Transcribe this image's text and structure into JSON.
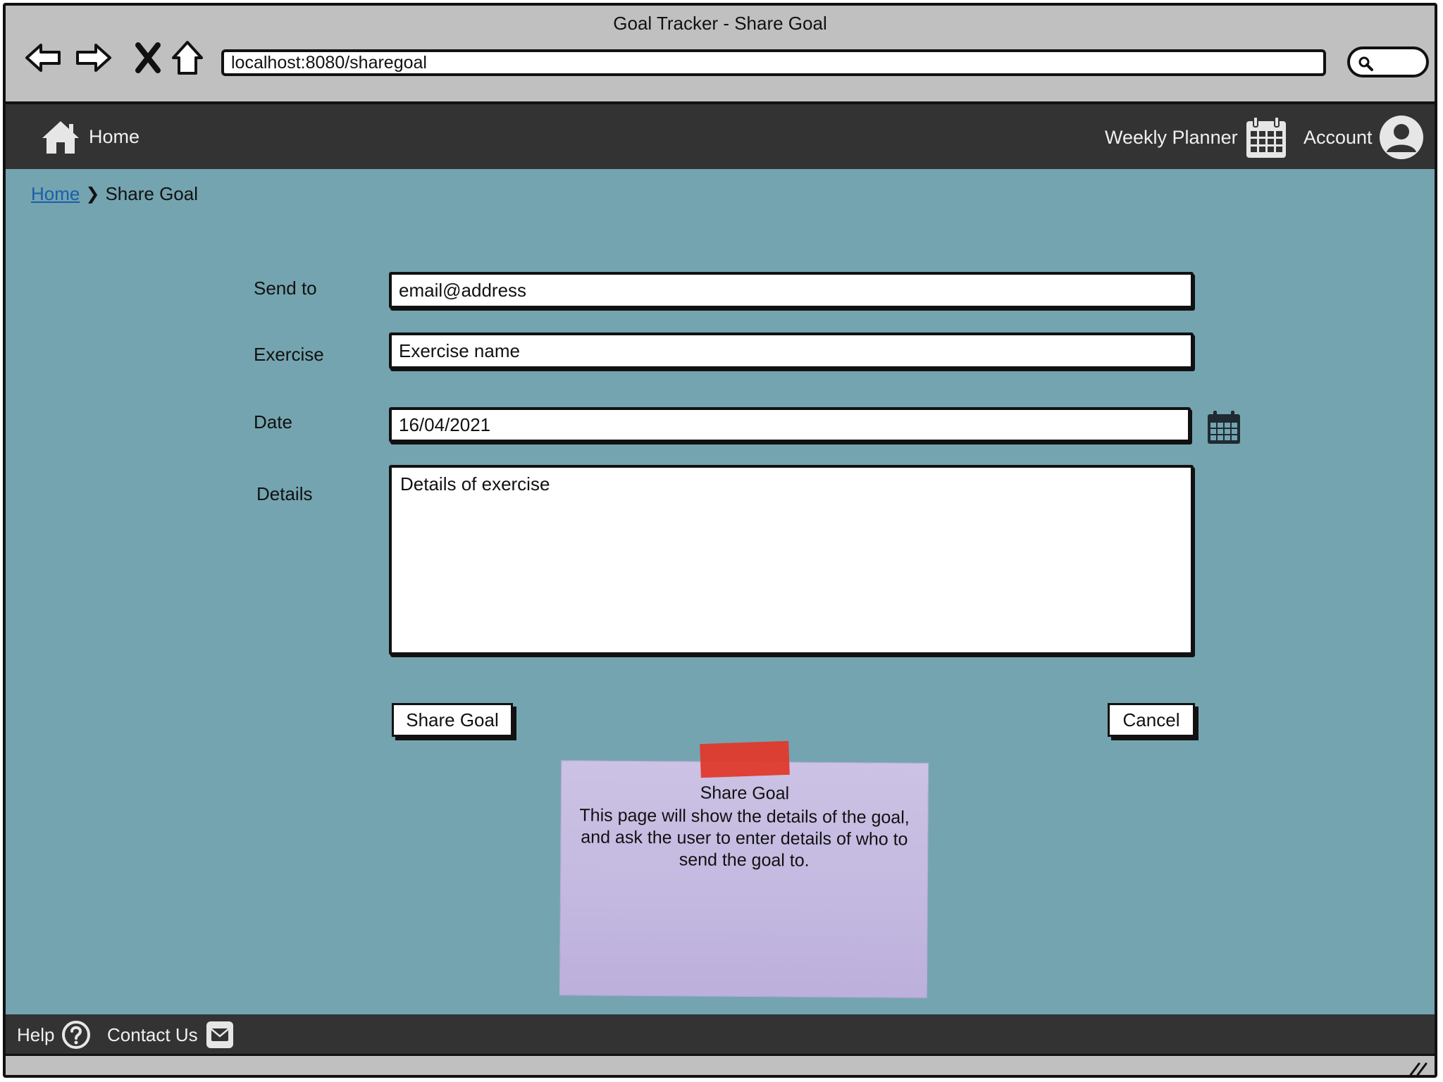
{
  "window": {
    "title": "Goal Tracker - Share Goal"
  },
  "browser": {
    "url": "localhost:8080/sharegoal",
    "icons": [
      "back-arrow-icon",
      "forward-arrow-icon",
      "stop-icon",
      "home-icon",
      "search-icon"
    ]
  },
  "topnav": {
    "home_label": "Home",
    "planner_label": "Weekly Planner",
    "account_label": "Account"
  },
  "breadcrumb": {
    "home": "Home",
    "current": "Share Goal"
  },
  "form": {
    "send_to_label": "Send to",
    "send_to_value": "email@address",
    "exercise_label": "Exercise",
    "exercise_value": "Exercise name",
    "date_label": "Date",
    "date_value": "16/04/2021",
    "details_label": "Details",
    "details_value": "Details of exercise",
    "share_button": "Share Goal",
    "cancel_button": "Cancel"
  },
  "note": {
    "title": "Share Goal",
    "body": "This page will show the details of the goal, and ask the user to enter details of who to send the goal to."
  },
  "footer": {
    "help_label": "Help",
    "contact_label": "Contact Us"
  },
  "colors": {
    "page_bg": "#74a4b0",
    "nav_bg": "#333333",
    "chrome_bg": "#c0c0c0",
    "note_bg": "#c4b9e0",
    "tape": "#e03a2c",
    "link": "#1a5fa8"
  }
}
